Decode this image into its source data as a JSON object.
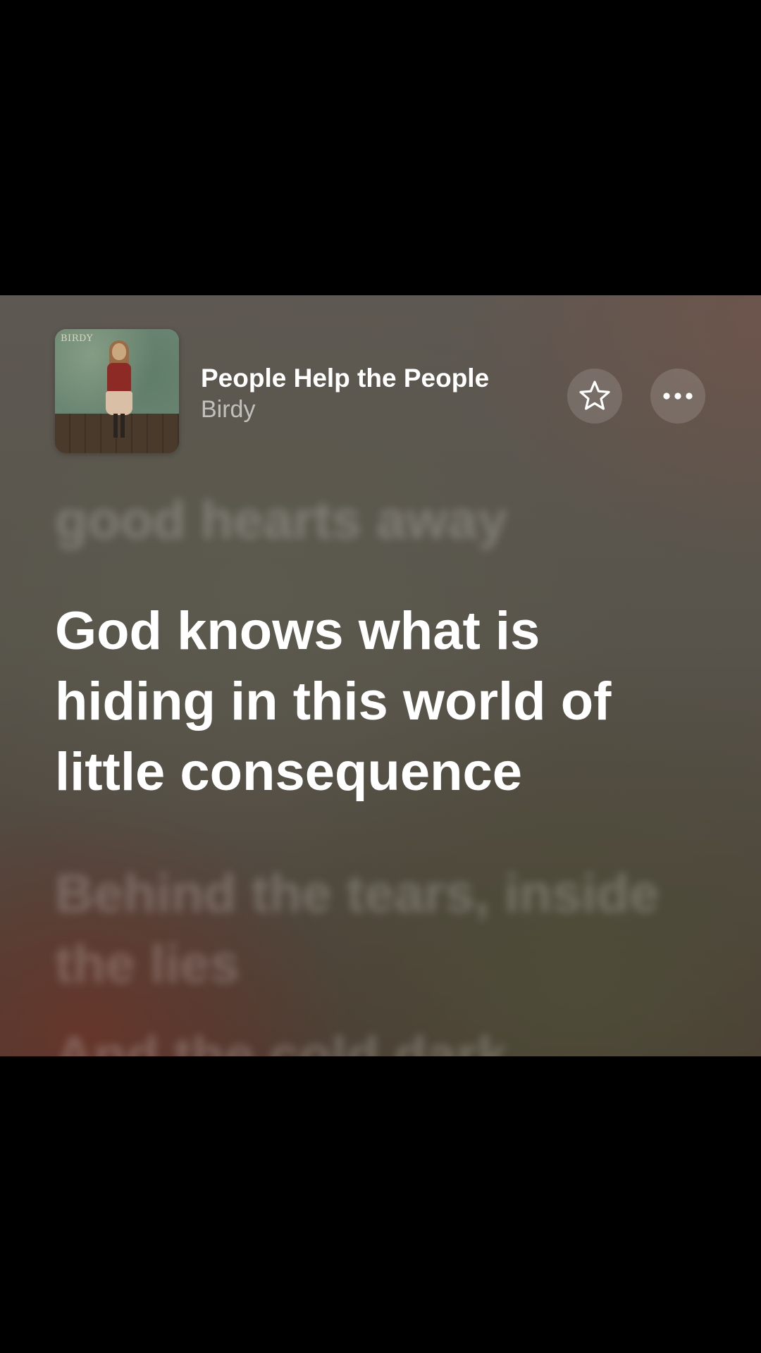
{
  "now_playing": {
    "title": "People Help the People",
    "artist": "Birdy",
    "album_art_text": "BIRDY",
    "actions": {
      "favorite_icon": "star-icon",
      "more_icon": "ellipsis-icon"
    }
  },
  "lyrics": {
    "previous": "good hearts away",
    "current": "God knows what is hiding in this world of little consequence",
    "next": "Behind the tears, inside the lies",
    "next2": "And the cold dark"
  },
  "colors": {
    "background_top": "#5e5852",
    "background_bottom": "#4a3b33",
    "accent_warm": "#6e3428",
    "text_primary": "#ffffff"
  }
}
